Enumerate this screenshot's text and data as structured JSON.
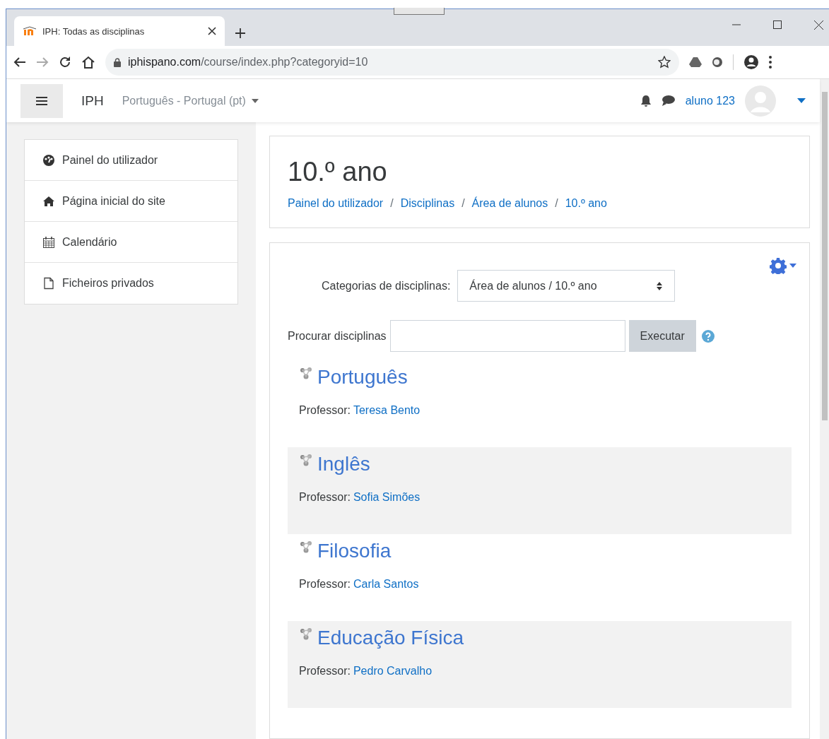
{
  "browser": {
    "tab_title": "IPH: Todas as disciplinas",
    "url_host": "iphispano.com",
    "url_path": "/course/index.php?categoryid=10"
  },
  "navbar": {
    "brand": "IPH",
    "language": "Português - Portugal (pt)",
    "user": "aluno 123"
  },
  "sidebar": {
    "items": [
      {
        "label": "Painel do utilizador",
        "kind": "dashboard"
      },
      {
        "label": "Página inicial do site",
        "kind": "home"
      },
      {
        "label": "Calendário",
        "kind": "calendar"
      },
      {
        "label": "Ficheiros privados",
        "kind": "file"
      }
    ]
  },
  "heading": {
    "title": "10.º ano",
    "separator": "/",
    "breadcrumb": [
      "Painel do utilizador",
      "Disciplinas",
      "Área de alunos",
      "10.º ano"
    ]
  },
  "categories": {
    "label": "Categorias de disciplinas:",
    "value": "Área de alunos / 10.º ano"
  },
  "search": {
    "label": "Procurar disciplinas",
    "button": "Executar"
  },
  "courses": [
    {
      "name": "Português",
      "teacher_label": "Professor:",
      "teacher": "Teresa Bento"
    },
    {
      "name": "Inglês",
      "teacher_label": "Professor:",
      "teacher": "Sofia Simões"
    },
    {
      "name": "Filosofia",
      "teacher_label": "Professor:",
      "teacher": "Carla Santos"
    },
    {
      "name": "Educação Física",
      "teacher_label": "Professor:",
      "teacher": "Pedro Carvalho"
    }
  ]
}
